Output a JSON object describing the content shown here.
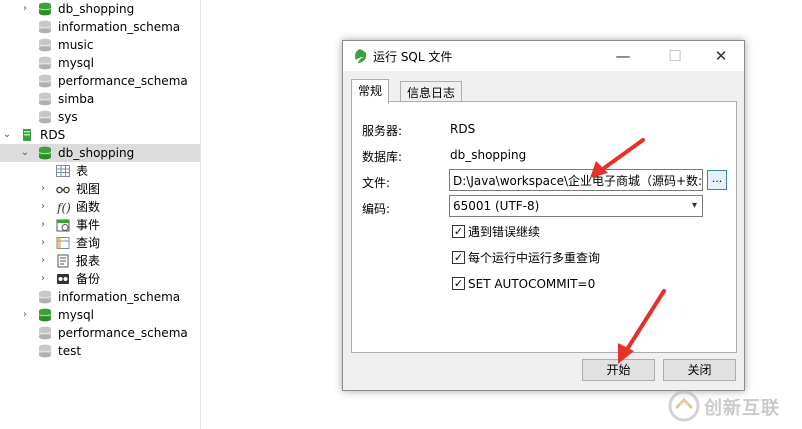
{
  "tree": {
    "items": [
      {
        "label": "db_shopping",
        "icon": "database-green-icon",
        "arrow": "›"
      },
      {
        "label": "information_schema",
        "icon": "database-gray-icon",
        "arrow": ""
      },
      {
        "label": "music",
        "icon": "database-gray-icon",
        "arrow": ""
      },
      {
        "label": "mysql",
        "icon": "database-gray-icon",
        "arrow": ""
      },
      {
        "label": "performance_schema",
        "icon": "database-gray-icon",
        "arrow": ""
      },
      {
        "label": "simba",
        "icon": "database-gray-icon",
        "arrow": ""
      },
      {
        "label": "sys",
        "icon": "database-gray-icon",
        "arrow": ""
      },
      {
        "label": "RDS",
        "icon": "server-icon",
        "arrow": "⌄"
      },
      {
        "label": "db_shopping",
        "icon": "database-green-icon",
        "arrow": "⌄"
      },
      {
        "label": "表",
        "icon": "table-icon",
        "arrow": ""
      },
      {
        "label": "视图",
        "icon": "view-icon",
        "arrow": "›"
      },
      {
        "label": "函数",
        "icon": "function-icon",
        "arrow": "›"
      },
      {
        "label": "事件",
        "icon": "event-icon",
        "arrow": "›"
      },
      {
        "label": "查询",
        "icon": "query-icon",
        "arrow": "›"
      },
      {
        "label": "报表",
        "icon": "report-icon",
        "arrow": "›"
      },
      {
        "label": "备份",
        "icon": "backup-icon",
        "arrow": "›"
      },
      {
        "label": "information_schema",
        "icon": "database-gray-icon",
        "arrow": ""
      },
      {
        "label": "mysql",
        "icon": "database-green-icon",
        "arrow": "›"
      },
      {
        "label": "performance_schema",
        "icon": "database-gray-icon",
        "arrow": ""
      },
      {
        "label": "test",
        "icon": "database-gray-icon",
        "arrow": ""
      }
    ]
  },
  "dialog": {
    "title": "运行 SQL 文件",
    "minimize": "—",
    "maximize": "☐",
    "close": "✕",
    "tabs": [
      "常规",
      "信息日志"
    ],
    "server_label": "服务器:",
    "server_value": "RDS",
    "database_label": "数据库:",
    "database_value": "db_shopping",
    "file_label": "文件:",
    "file_value": "D:\\Java\\workspace\\企业电子商城（源码+数:",
    "browse_label": "...",
    "encoding_label": "编码:",
    "encoding_value": "65001 (UTF-8)",
    "checkbox1": "遇到错误继续",
    "checkbox2": "每个运行中运行多重查询",
    "checkbox3": "SET AUTOCOMMIT=0",
    "start_button": "开始",
    "close_button": "关闭"
  },
  "watermark": {
    "text": "创新互联"
  },
  "colors": {
    "accent_green": "#3aa23a",
    "selected_row": "#dcdcdc",
    "arrow_red": "#e8302a"
  }
}
